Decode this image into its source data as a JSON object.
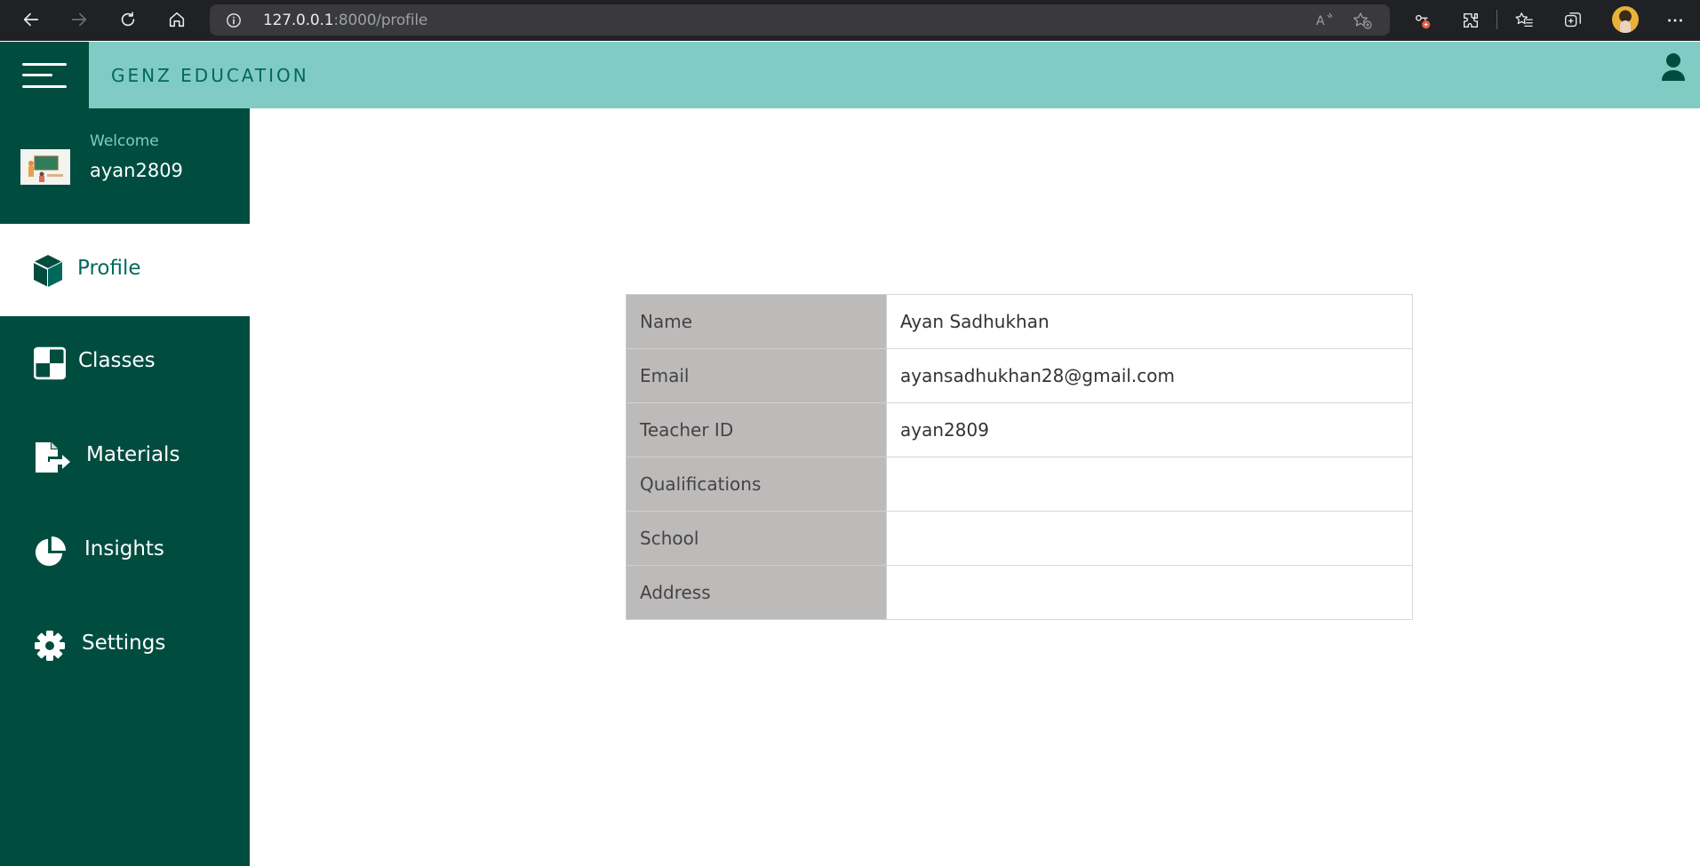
{
  "browser": {
    "url_host": "127.0.0.1",
    "url_path": ":8000/profile",
    "icons": [
      "back-icon",
      "forward-icon",
      "refresh-icon",
      "home-icon",
      "info-icon",
      "read-aloud-icon",
      "add-favorite-icon",
      "extension-icon",
      "extensions-icon",
      "favorites-icon",
      "collections-icon",
      "profile-avatar",
      "more-icon"
    ]
  },
  "header": {
    "brand": "GENZ EDUCATION"
  },
  "sidebar": {
    "welcome_label": "Welcome",
    "username": "ayan2809",
    "items": [
      {
        "label": "Profile",
        "icon": "cube-icon",
        "active": true
      },
      {
        "label": "Classes",
        "icon": "checkerboard-icon",
        "active": false
      },
      {
        "label": "Materials",
        "icon": "file-export-icon",
        "active": false
      },
      {
        "label": "Insights",
        "icon": "pie-chart-icon",
        "active": false
      },
      {
        "label": "Settings",
        "icon": "gear-icon",
        "active": false
      }
    ]
  },
  "profile": {
    "rows": [
      {
        "label": "Name",
        "value": "Ayan Sadhukhan"
      },
      {
        "label": "Email",
        "value": "ayansadhukhan28@gmail.com"
      },
      {
        "label": "Teacher ID",
        "value": "ayan2809"
      },
      {
        "label": "Qualifications",
        "value": ""
      },
      {
        "label": "School",
        "value": ""
      },
      {
        "label": "Address",
        "value": ""
      }
    ]
  },
  "colors": {
    "primary_dark": "#004d40",
    "header_teal": "#80cbc4",
    "accent_text": "#00695c",
    "table_key_bg": "#bdbaba"
  }
}
